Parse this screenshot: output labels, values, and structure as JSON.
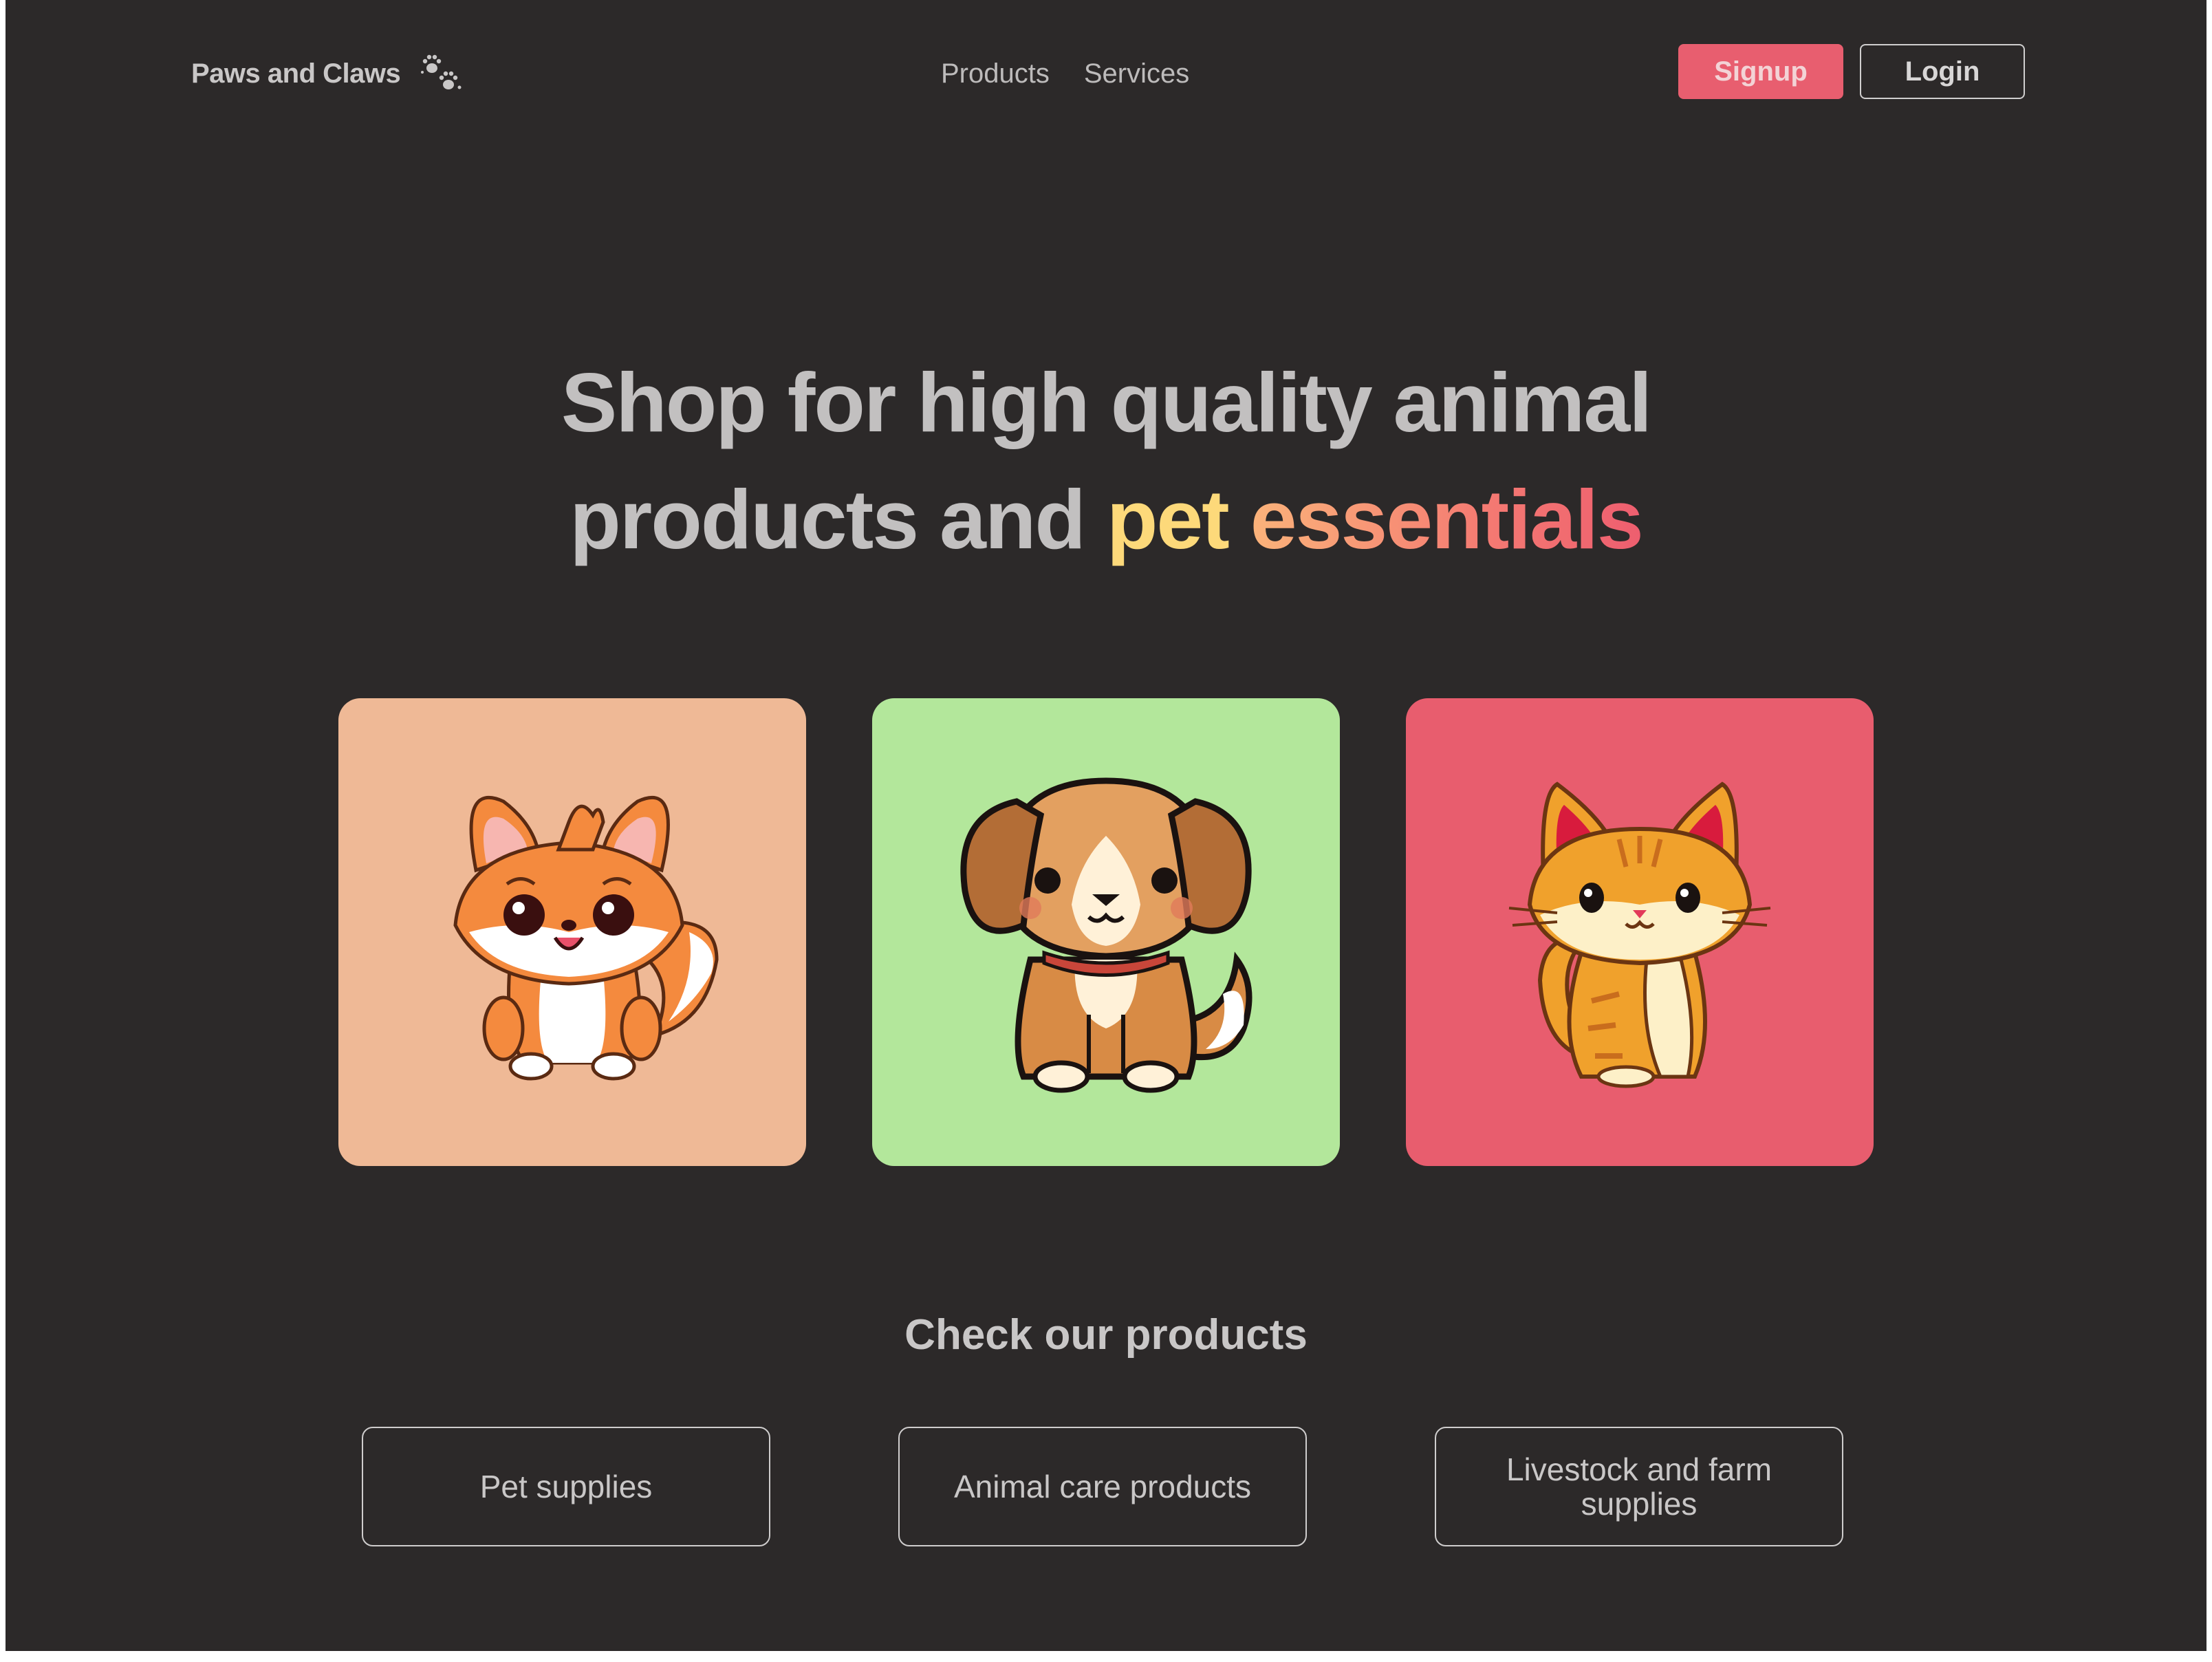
{
  "header": {
    "brand": "Paws and Claws",
    "brand_icon": "paw-prints-icon",
    "nav": [
      {
        "label": "Products"
      },
      {
        "label": "Services"
      }
    ],
    "signup_label": "Signup",
    "login_label": "Login"
  },
  "hero": {
    "line1": "Shop for high quality animal",
    "line2_prefix": "products and ",
    "line2_pet": "pet",
    "line2_space": " ",
    "line2_essentials": "essentials"
  },
  "cards": [
    {
      "animal": "fox",
      "color": "#efb996"
    },
    {
      "animal": "dog",
      "color": "#b3e79b"
    },
    {
      "animal": "cat",
      "color": "#e85d6e"
    }
  ],
  "products": {
    "title": "Check our products",
    "items": [
      {
        "label": "Pet supplies"
      },
      {
        "label": "Animal care products"
      },
      {
        "label": "Livestock and farm supplies"
      }
    ]
  },
  "colors": {
    "background": "#2c2929",
    "accent": "#e85e6f",
    "highlight_yellow": "#fdd97a",
    "highlight_orange": "#fbb37a"
  }
}
